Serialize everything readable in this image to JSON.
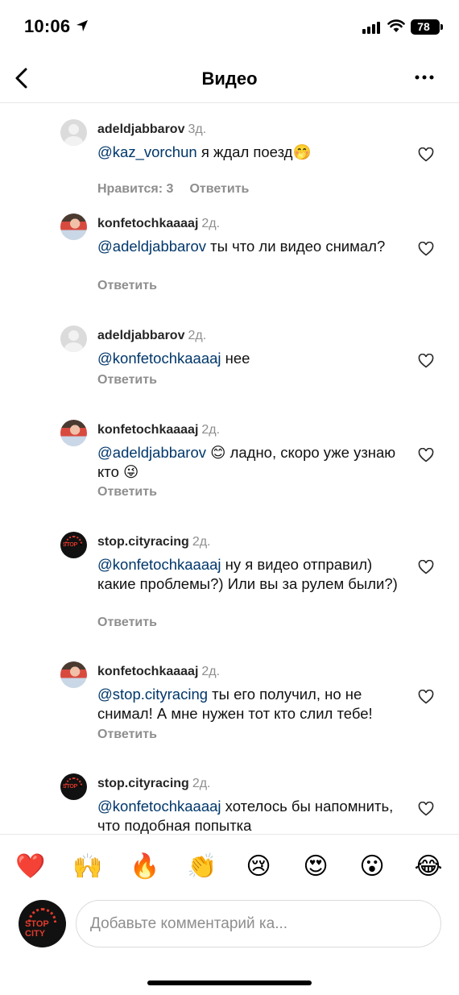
{
  "status_bar": {
    "time": "10:06",
    "battery": "78"
  },
  "header": {
    "title": "Видео",
    "back_icon": "chevron-left-icon",
    "more_icon": "more-horizontal-icon"
  },
  "comments": [
    {
      "username": "adeldjabbarov",
      "time": "3д.",
      "mention": "@kaz_vorchun",
      "text": " я ждал поезд🤭",
      "likes_label": "Нравится: 3",
      "reply_label": "Ответить",
      "avatar": "default"
    },
    {
      "username": "konfetochkaaaaj",
      "time": "2д.",
      "mention": "@adeldjabbarov",
      "text": " ты что ли видео снимал?",
      "reply_label": "Ответить",
      "avatar": "photo"
    },
    {
      "username": "adeldjabbarov",
      "time": "2д.",
      "mention": "@konfetochkaaaaj",
      "text": " нее",
      "reply_label": "Ответить",
      "avatar": "default"
    },
    {
      "username": "konfetochkaaaaj",
      "time": "2д.",
      "mention": "@adeldjabbarov",
      "text": " 😊 ладно, скоро уже узнаю кто 😜",
      "reply_label": "Ответить",
      "avatar": "photo"
    },
    {
      "username": "stop.cityracing",
      "time": "2д.",
      "mention": "@konfetochkaaaaj",
      "text": "  ну я видео отправил) какие проблемы?) Или вы за рулем были?)",
      "reply_label": "Ответить",
      "avatar": "brand"
    },
    {
      "username": "konfetochkaaaaj",
      "time": "2д.",
      "mention": "@stop.cityracing",
      "text": " ты его получил, но не снимал! А мне нужен тот кто слил тебе!",
      "reply_label": "Ответить",
      "avatar": "photo"
    },
    {
      "username": "stop.cityracing",
      "time": "2д.",
      "mention": "@konfetochkaaaaj",
      "text": " хотелось бы напомнить, что подобная попытка",
      "avatar": "brand"
    }
  ],
  "emoji_bar": [
    "❤️",
    "🙌",
    "🔥",
    "👏",
    "😢",
    "😍",
    "😮",
    "😂"
  ],
  "composer": {
    "placeholder": "Добавьте комментарий ка...",
    "avatar_text": "STOP CITY"
  },
  "colors": {
    "mention": "#00376b",
    "secondary": "#8e8e8e",
    "divider": "#e8e8e8"
  }
}
